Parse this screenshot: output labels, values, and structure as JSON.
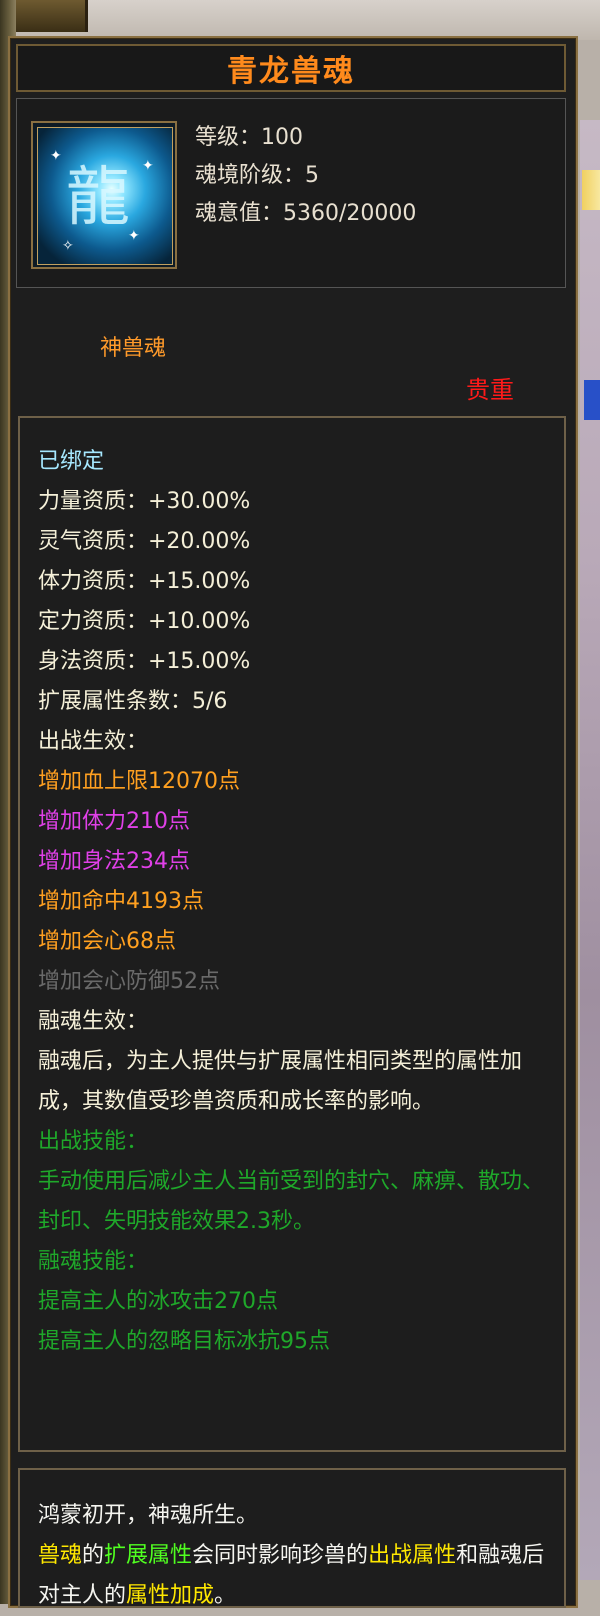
{
  "item": {
    "title": "青龙兽魂",
    "icon": "azure-dragon-soul-icon",
    "stats": [
      "等级：100",
      "魂境阶级：5",
      "魂意值：5360/20000"
    ],
    "subtitle": "神兽魂",
    "rarity": "贵重"
  },
  "details": {
    "bound": "已绑定",
    "aptitudes": [
      "力量资质：+30.00%",
      "灵气资质：+20.00%",
      "体力资质：+15.00%",
      "定力资质：+10.00%",
      "身法资质：+15.00%"
    ],
    "ext_count": "扩展属性条数：5/6",
    "battle_header": "出战生效：",
    "battle_effects": [
      {
        "text": "增加血上限12070点",
        "color": "#ffa020"
      },
      {
        "text": "增加体力210点",
        "color": "#e040e8"
      },
      {
        "text": "增加身法234点",
        "color": "#e040e8"
      },
      {
        "text": "增加命中4193点",
        "color": "#ffa020"
      },
      {
        "text": "增加会心68点",
        "color": "#ffa020"
      },
      {
        "text": "增加会心防御52点",
        "color": "#6a6a6a"
      }
    ],
    "fusion_header": "融魂生效：",
    "fusion_desc": "融魂后，为主人提供与扩展属性相同类型的属性加成，其数值受珍兽资质和成长率的影响。",
    "battle_skill_header": "出战技能：",
    "battle_skill_desc": "手动使用后减少主人当前受到的封穴、麻痹、散功、封印、失明技能效果2.3秒。",
    "fusion_skill_header": "融魂技能：",
    "fusion_skills": [
      "提高主人的冰攻击270点",
      "提高主人的忽略目标冰抗95点"
    ]
  },
  "lore": {
    "line1": "鸿蒙初开，神魂所生。",
    "seg1": "兽魂",
    "seg2": "的",
    "seg3": "扩展属性",
    "seg4": "会同时影响珍兽的",
    "seg5": "出战",
    "seg6": "属性",
    "seg7": "和融魂后对主人的",
    "seg8": "属性加成",
    "seg9": "。"
  }
}
